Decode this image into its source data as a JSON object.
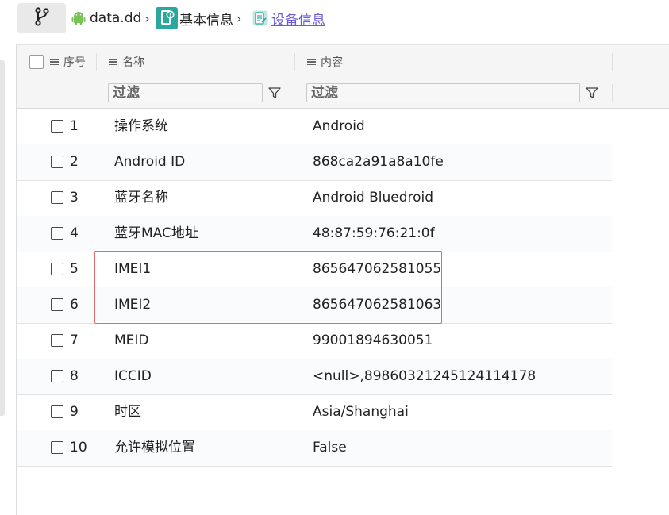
{
  "breadcrumb": {
    "items": [
      {
        "label": "data.dd",
        "icon": "android-icon"
      },
      {
        "label": "基本信息",
        "icon": "info-doc-icon"
      },
      {
        "label": "设备信息",
        "icon": "device-doc-icon"
      }
    ],
    "branch_icon": "branch-icon"
  },
  "columns": {
    "index": "序号",
    "name": "名称",
    "content": "内容"
  },
  "filters": {
    "name_placeholder": "过滤",
    "content_placeholder": "过滤"
  },
  "rows": [
    {
      "index": "1",
      "name": "操作系统",
      "content": "Android"
    },
    {
      "index": "2",
      "name": "Android ID",
      "content": "868ca2a91a8a10fe"
    },
    {
      "index": "3",
      "name": "蓝牙名称",
      "content": "Android Bluedroid"
    },
    {
      "index": "4",
      "name": "蓝牙MAC地址",
      "content": "48:87:59:76:21:0f"
    },
    {
      "index": "5",
      "name": "IMEI1",
      "content": "865647062581055"
    },
    {
      "index": "6",
      "name": "IMEI2",
      "content": "865647062581063"
    },
    {
      "index": "7",
      "name": "MEID",
      "content": "99001894630051"
    },
    {
      "index": "8",
      "name": "ICCID",
      "content": "<null>,89860321245124114178"
    },
    {
      "index": "9",
      "name": "时区",
      "content": "Asia/Shanghai"
    },
    {
      "index": "10",
      "name": "允许模拟位置",
      "content": "False"
    }
  ],
  "colors": {
    "accent_link": "#6b5bd6",
    "highlight_box": "#e36a6a",
    "android_green": "#78c257",
    "teal_icon": "#2aa8a0"
  }
}
